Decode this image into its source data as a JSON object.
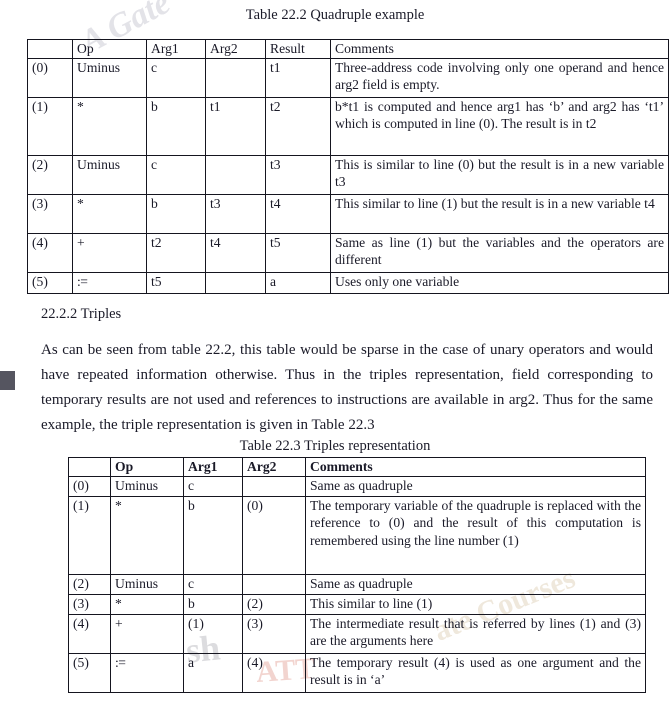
{
  "watermarks": {
    "top_left": "A Gate",
    "bottom_right": "ate Courses",
    "bottom_left": "sh",
    "red": "ATT"
  },
  "table_22_2": {
    "title": "Table 22.2 Quadruple example",
    "headers": [
      "",
      "Op",
      "Arg1",
      "Arg2",
      "Result",
      "Comments"
    ],
    "rows": [
      {
        "index": "(0)",
        "op": "Uminus",
        "arg1": "c",
        "arg2": "",
        "result": "t1",
        "comments": "Three-address code involving only one operand and hence arg2 field is empty."
      },
      {
        "index": "(1)",
        "op": "*",
        "arg1": "b",
        "arg2": "t1",
        "result": "t2",
        "comments": "b*t1 is computed and hence arg1 has ‘b’ and arg2 has ‘t1’ which is computed in line (0). The result is in t2"
      },
      {
        "index": "(2)",
        "op": "Uminus",
        "arg1": "c",
        "arg2": "",
        "result": "t3",
        "comments": "This is similar to line (0) but the result is in a new variable t3"
      },
      {
        "index": "(3)",
        "op": "*",
        "arg1": "b",
        "arg2": "t3",
        "result": "t4",
        "comments": "This similar to line (1) but the result is in a new variable t4"
      },
      {
        "index": "(4)",
        "op": "+",
        "arg1": "t2",
        "arg2": "t4",
        "result": "t5",
        "comments": "Same as line (1) but the variables and the operators are different"
      },
      {
        "index": "(5)",
        "op": ":=",
        "arg1": "t5",
        "arg2": "",
        "result": "a",
        "comments": "Uses only one variable"
      }
    ]
  },
  "section": {
    "heading": "22.2.2 Triples",
    "paragraph": "As can be seen from table 22.2, this table would be sparse in the case of unary operators and would have repeated information otherwise. Thus in the triples representation, field corresponding to temporary results are not used and references to instructions are available in arg2. Thus for the same example, the triple representation is given in Table 22.3"
  },
  "table_22_3": {
    "title": "Table 22.3 Triples representation",
    "headers": [
      "",
      "Op",
      "Arg1",
      "Arg2",
      "Comments"
    ],
    "rows": [
      {
        "index": "(0)",
        "op": "Uminus",
        "arg1": "c",
        "arg2": "",
        "comments": "Same as quadruple"
      },
      {
        "index": "(1)",
        "op": "*",
        "arg1": "b",
        "arg2": "(0)",
        "comments": "The temporary variable of the quadruple is replaced with the reference to (0) and the result of this computation is remembered using the line number (1)"
      },
      {
        "index": "(2)",
        "op": "Uminus",
        "arg1": "c",
        "arg2": "",
        "comments": "Same as quadruple"
      },
      {
        "index": "(3)",
        "op": "*",
        "arg1": "b",
        "arg2": "(2)",
        "comments": "This similar to line (1)"
      },
      {
        "index": "(4)",
        "op": "+",
        "arg1": "(1)",
        "arg2": "(3)",
        "comments": "The intermediate result that is referred by lines (1) and (3) are the arguments here"
      },
      {
        "index": "(5)",
        "op": ":=",
        "arg1": "a",
        "arg2": "(4)",
        "comments": "The temporary result (4) is used as one argument and the result is in ‘a’"
      }
    ]
  }
}
